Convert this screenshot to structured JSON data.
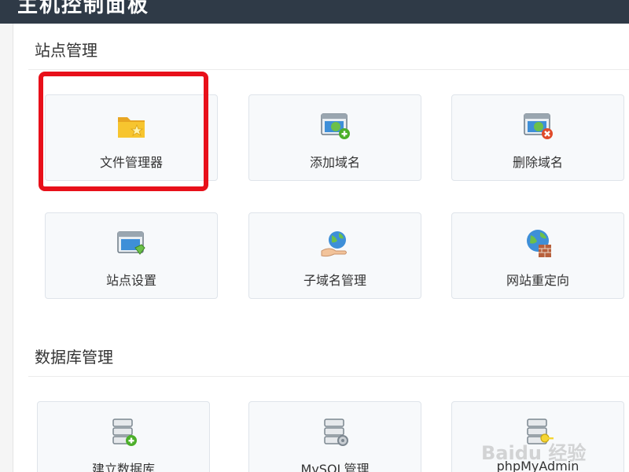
{
  "header": {
    "title": "主机控制面板"
  },
  "sections": [
    {
      "title": "站点管理",
      "tiles": [
        {
          "label": "文件管理器",
          "icon": "folder-star-icon"
        },
        {
          "label": "添加域名",
          "icon": "browser-globe-add-icon"
        },
        {
          "label": "删除域名",
          "icon": "browser-globe-remove-icon"
        },
        {
          "label": "站点设置",
          "icon": "browser-settings-icon"
        },
        {
          "label": "子域名管理",
          "icon": "globe-hand-icon"
        },
        {
          "label": "网站重定向",
          "icon": "globe-firewall-icon"
        }
      ]
    },
    {
      "title": "数据库管理",
      "tiles": [
        {
          "label": "建立数据库",
          "icon": "database-add-icon"
        },
        {
          "label": "MySQL管理",
          "icon": "database-gear-icon"
        },
        {
          "label": "phpMyAdmin",
          "icon": "database-key-icon"
        }
      ]
    }
  ],
  "annotation": {
    "highlight_color": "#e8101a",
    "highlighted_tile": "文件管理器"
  },
  "watermark": {
    "text": "Baidu 经验"
  },
  "colors": {
    "topbar": "#2f3a47",
    "tile_bg": "#f7f9fb",
    "tile_border": "#dfe4ea"
  }
}
